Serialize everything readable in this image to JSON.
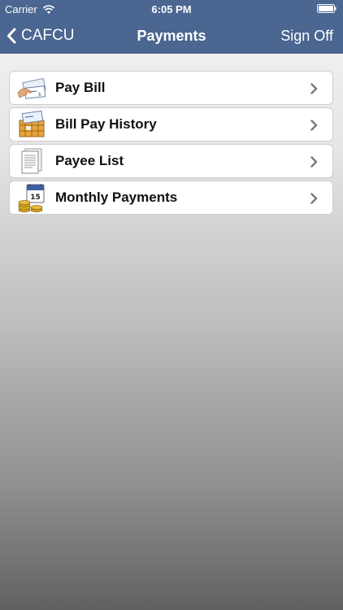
{
  "status_bar": {
    "carrier": "Carrier",
    "time": "6:05 PM"
  },
  "nav": {
    "back_label": "CAFCU",
    "title": "Payments",
    "sign_off_label": "Sign Off"
  },
  "menu": {
    "items": [
      {
        "label": "Pay Bill",
        "icon": "pay-bill-icon"
      },
      {
        "label": "Bill Pay History",
        "icon": "bill-pay-history-icon"
      },
      {
        "label": "Payee List",
        "icon": "payee-list-icon"
      },
      {
        "label": "Monthly Payments",
        "icon": "monthly-payments-icon"
      }
    ]
  },
  "colors": {
    "nav_background": "#4a6691",
    "nav_text": "#ffffff",
    "chevron": "#7a7a7a"
  }
}
